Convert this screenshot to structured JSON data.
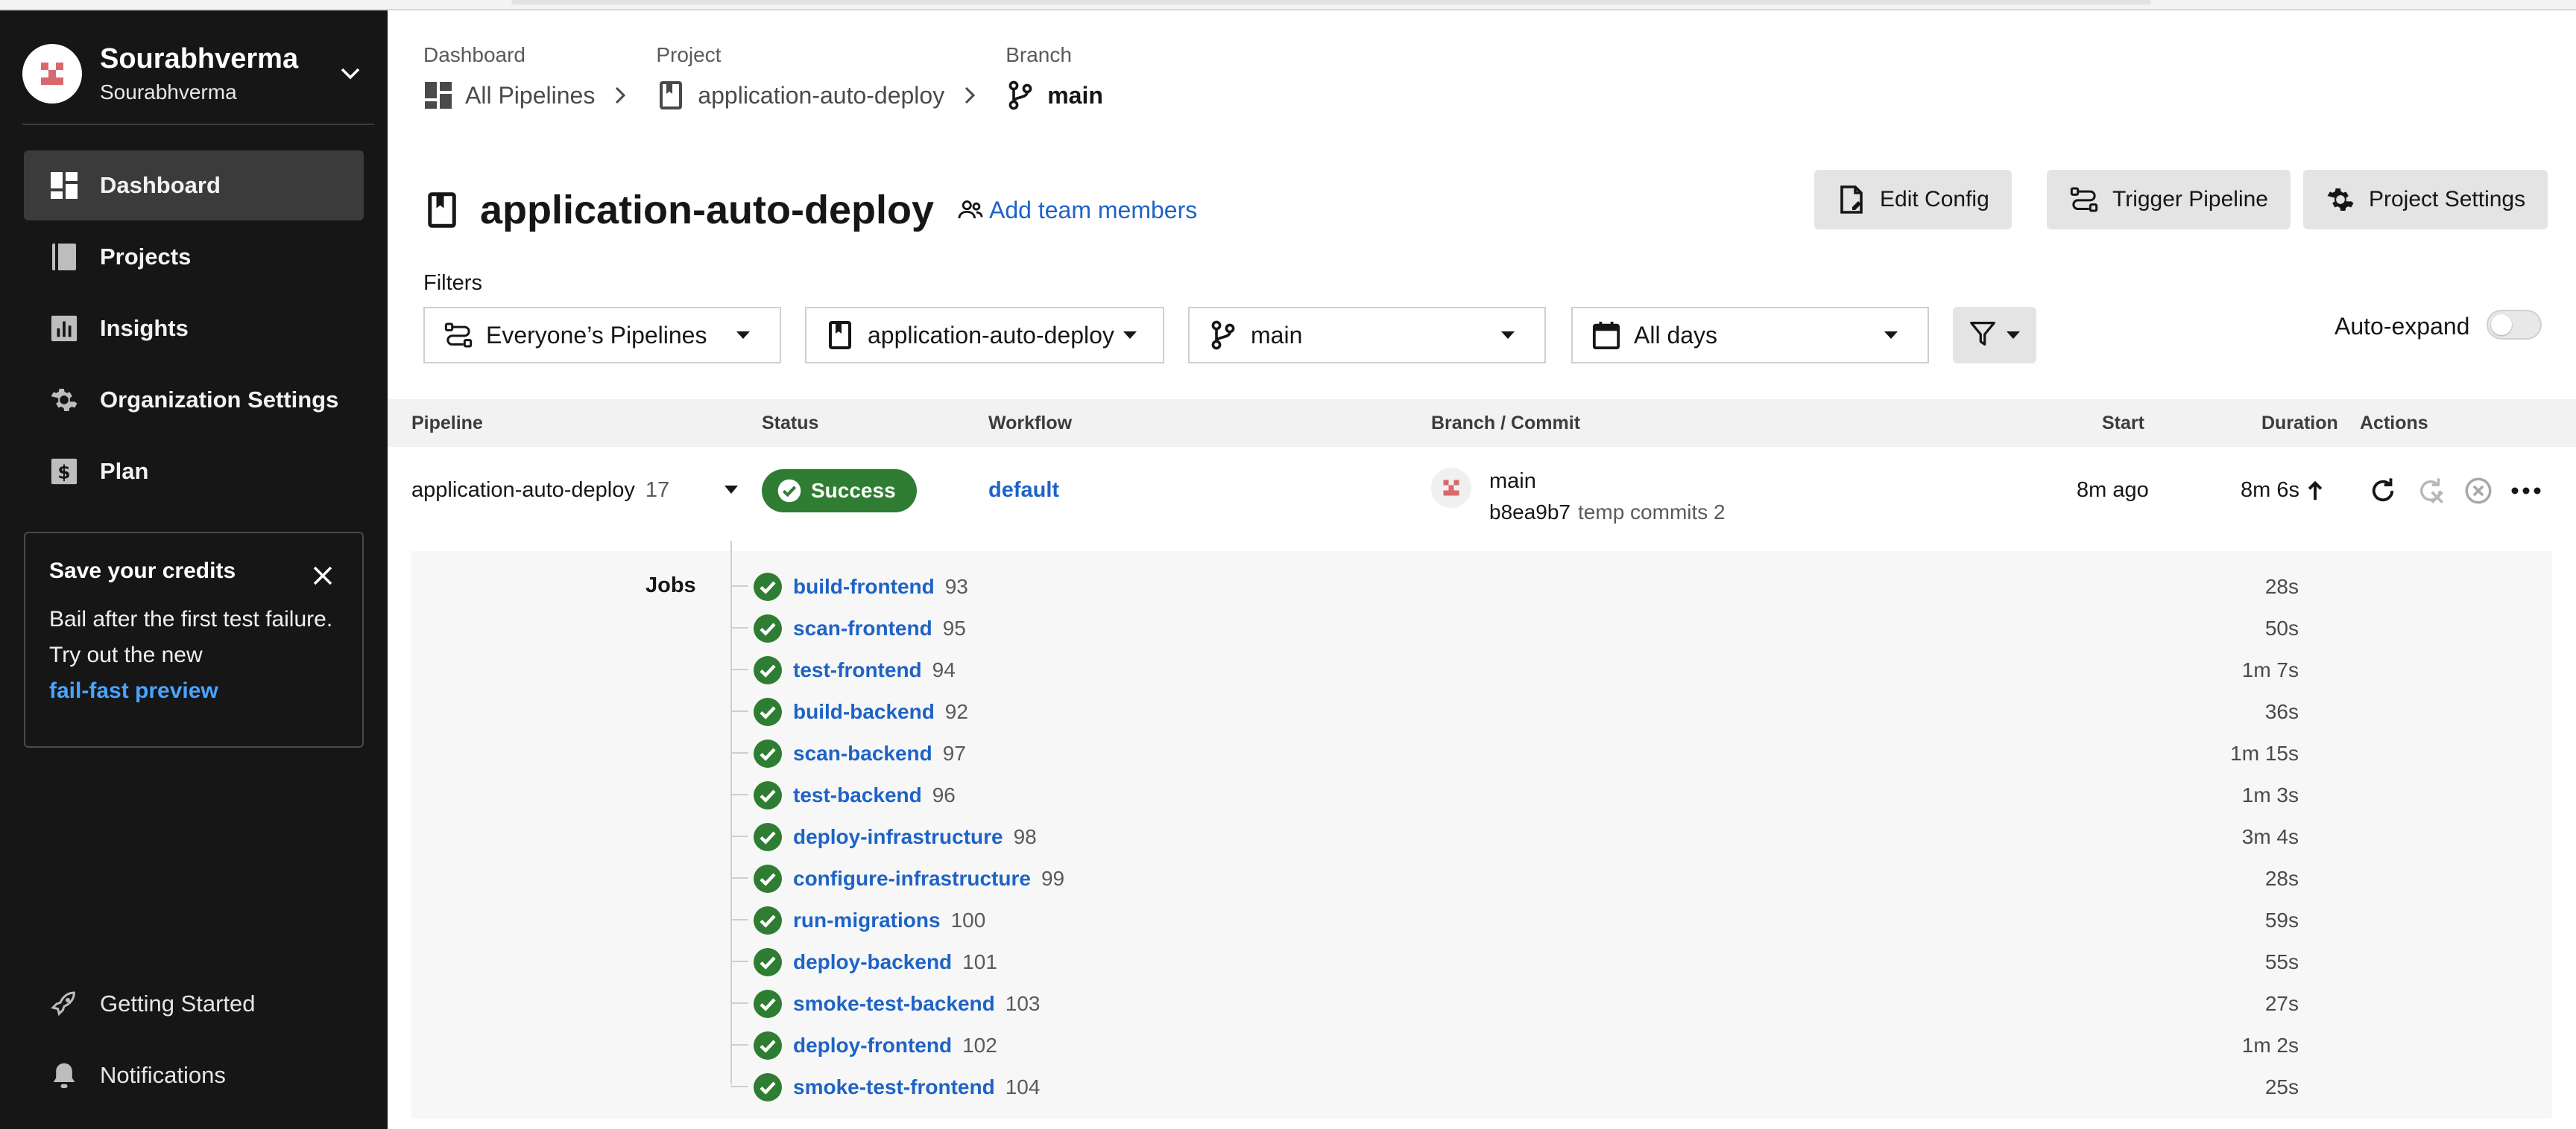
{
  "sidebar": {
    "org_name": "Sourabhverma",
    "org_sub": "Sourabhverma",
    "items": [
      {
        "label": "Dashboard",
        "icon": "dashboard-icon",
        "active": true
      },
      {
        "label": "Projects",
        "icon": "projects-icon"
      },
      {
        "label": "Insights",
        "icon": "insights-icon"
      },
      {
        "label": "Organization Settings",
        "icon": "gear-icon"
      },
      {
        "label": "Plan",
        "icon": "plan-icon"
      }
    ],
    "promo": {
      "title": "Save your credits",
      "body": "Bail after the first test failure. Try out the new",
      "link": "fail-fast preview"
    },
    "bottom": [
      {
        "label": "Getting Started",
        "icon": "rocket-icon"
      },
      {
        "label": "Notifications",
        "icon": "bell-icon"
      }
    ]
  },
  "breadcrumb": [
    {
      "caption": "Dashboard",
      "value": "All Pipelines"
    },
    {
      "caption": "Project",
      "value": "application-auto-deploy"
    },
    {
      "caption": "Branch",
      "value": "main"
    }
  ],
  "header": {
    "title": "application-auto-deploy",
    "add_team": "Add team members",
    "edit_config": "Edit Config",
    "trigger_pipeline": "Trigger Pipeline",
    "project_settings": "Project Settings"
  },
  "filters": {
    "label": "Filters",
    "pipelines": "Everyone’s Pipelines",
    "project": "application-auto-deploy",
    "branch": "main",
    "days": "All days",
    "auto_expand": "Auto-expand"
  },
  "table": {
    "headers": {
      "pipeline": "Pipeline",
      "status": "Status",
      "workflow": "Workflow",
      "branch_commit": "Branch / Commit",
      "start": "Start",
      "duration": "Duration",
      "actions": "Actions"
    },
    "row": {
      "pipeline": "application-auto-deploy",
      "number": "17",
      "status": "Success",
      "workflow": "default",
      "branch": "main",
      "sha": "b8ea9b7",
      "commit_msg": "temp commits 2",
      "start": "8m ago",
      "duration": "8m 6s"
    }
  },
  "jobs": {
    "label": "Jobs",
    "list": [
      {
        "name": "build-frontend",
        "number": "93",
        "duration": "28s"
      },
      {
        "name": "scan-frontend",
        "number": "95",
        "duration": "50s"
      },
      {
        "name": "test-frontend",
        "number": "94",
        "duration": "1m 7s"
      },
      {
        "name": "build-backend",
        "number": "92",
        "duration": "36s"
      },
      {
        "name": "scan-backend",
        "number": "97",
        "duration": "1m 15s"
      },
      {
        "name": "test-backend",
        "number": "96",
        "duration": "1m 3s"
      },
      {
        "name": "deploy-infrastructure",
        "number": "98",
        "duration": "3m 4s"
      },
      {
        "name": "configure-infrastructure",
        "number": "99",
        "duration": "28s"
      },
      {
        "name": "run-migrations",
        "number": "100",
        "duration": "59s"
      },
      {
        "name": "deploy-backend",
        "number": "101",
        "duration": "55s"
      },
      {
        "name": "smoke-test-backend",
        "number": "103",
        "duration": "27s"
      },
      {
        "name": "deploy-frontend",
        "number": "102",
        "duration": "1m 2s"
      },
      {
        "name": "smoke-test-frontend",
        "number": "104",
        "duration": "25s"
      }
    ]
  },
  "colors": {
    "sidebar_bg": "#161616",
    "success": "#2e7d32",
    "link": "#1e63c6",
    "promo_link": "#4aa3ff"
  }
}
